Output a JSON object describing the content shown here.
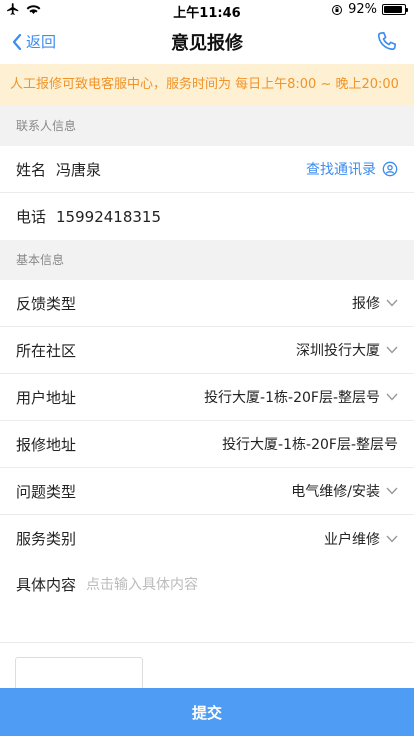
{
  "status_bar": {
    "time": "上午11:46",
    "battery_percent": "92%",
    "battery_level": 0.92
  },
  "nav": {
    "back_label": "返回",
    "title": "意见报修"
  },
  "notice": {
    "text": "人工报修可致电客服中心，服务时间为 每日上午8:00 ~ 晚上20:00"
  },
  "contact": {
    "section_title": "联系人信息",
    "name_label": "姓名",
    "name_value": "冯唐泉",
    "lookup_label": "查找通讯录",
    "phone_label": "电话",
    "phone_value": "15992418315"
  },
  "basic": {
    "section_title": "基本信息",
    "rows": [
      {
        "label": "反馈类型",
        "value": "报修",
        "chevron": true
      },
      {
        "label": "所在社区",
        "value": "深圳投行大厦",
        "chevron": true
      },
      {
        "label": "用户地址",
        "value": "投行大厦-1栋-20F层-整层号",
        "chevron": true
      },
      {
        "label": "报修地址",
        "value": "投行大厦-1栋-20F层-整层号",
        "chevron": false
      },
      {
        "label": "问题类型",
        "value": "电气维修/安装",
        "chevron": true
      },
      {
        "label": "服务类别",
        "value": "业户维修",
        "chevron": true
      }
    ],
    "content_label": "具体内容",
    "content_placeholder": "点击输入具体内容"
  },
  "submit_label": "提交",
  "colors": {
    "accent": "#3d8cf0",
    "notice_bg": "#fdf0d3",
    "notice_text": "#f0942a",
    "submit_bg": "#4f9cf4"
  }
}
